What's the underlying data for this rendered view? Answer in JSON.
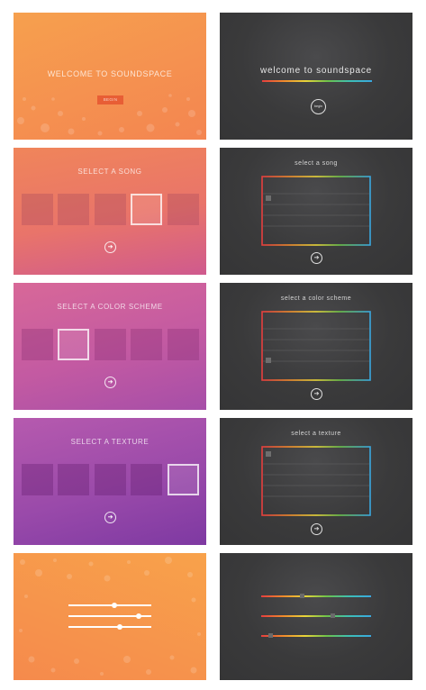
{
  "screens": {
    "welcome": {
      "title": "WELCOME TO SOUNDSPACE",
      "begin_label": "BEGIN"
    },
    "welcome_dark": {
      "title": "welcome to soundspace",
      "begin_label": "begin"
    },
    "song": {
      "title": "SELECT A SONG",
      "selected_index": 3
    },
    "song_dark": {
      "title": "select a song"
    },
    "color": {
      "title": "SELECT A COLOR SCHEME",
      "selected_index": 1
    },
    "color_dark": {
      "title": "select a color scheme"
    },
    "texture": {
      "title": "SELECT A TEXTURE",
      "selected_index": 4
    },
    "texture_dark": {
      "title": "select a texture"
    },
    "sliders": {
      "values": [
        0.55,
        0.85,
        0.62
      ]
    },
    "sliders_dark": {
      "values": [
        0.37,
        0.65,
        0.09
      ]
    }
  },
  "icons": {
    "next": "arrow-right-circle-icon"
  },
  "colors": {
    "orange": "#f6a04e",
    "coral": "#f0855a",
    "magenta": "#c35aa2",
    "purple": "#8a42a6",
    "dark_panel": "#3a3a3b",
    "spectrum": [
      "#e53e3e",
      "#f08a2c",
      "#e8d53a",
      "#6cc24a",
      "#3dbfb5",
      "#3aa8e0"
    ]
  }
}
